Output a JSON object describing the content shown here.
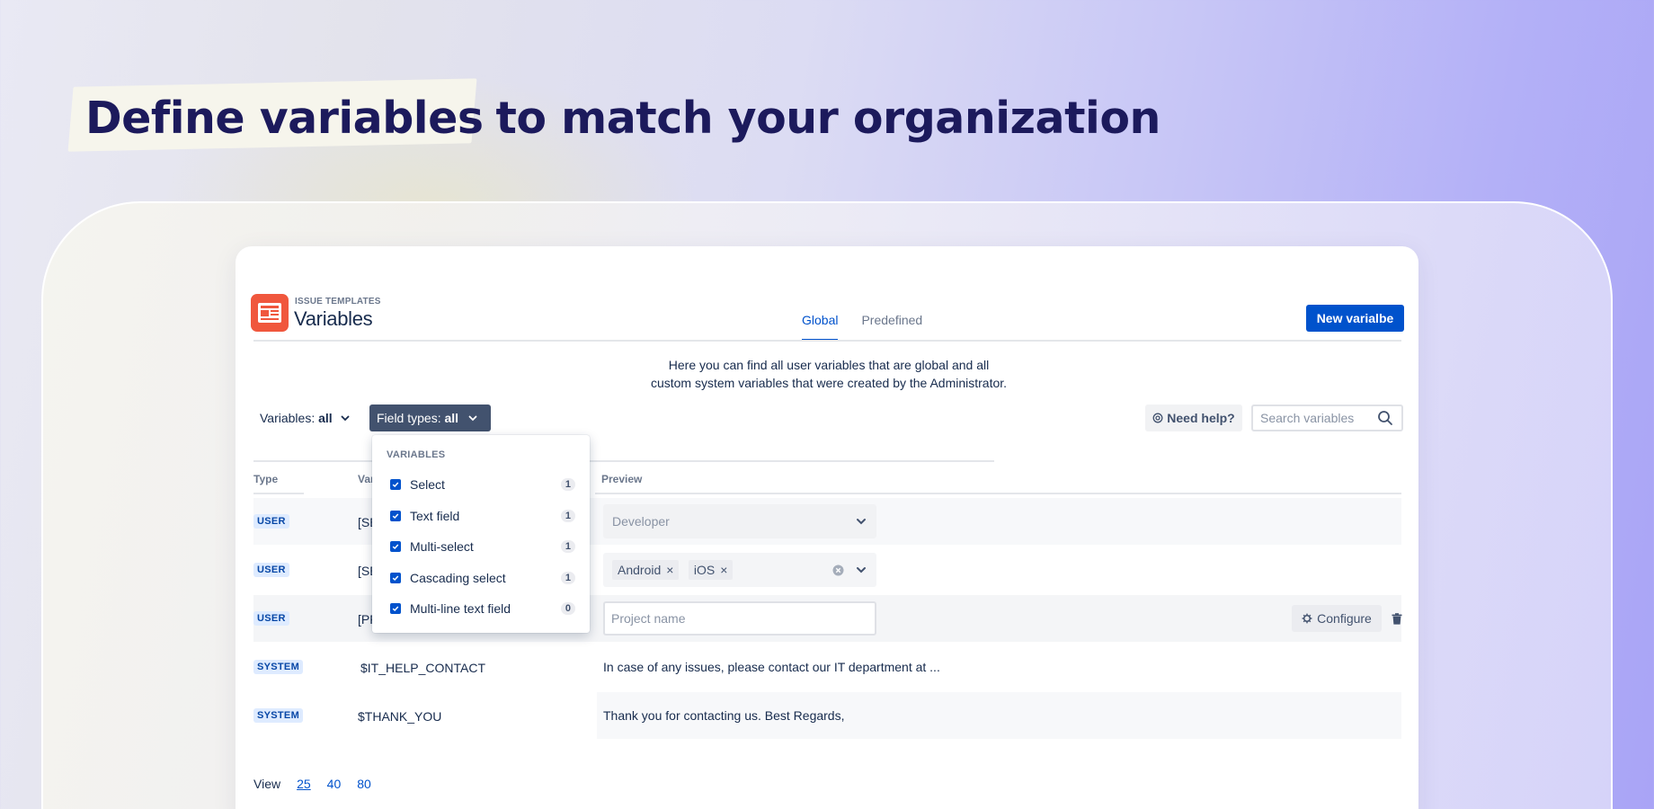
{
  "headline": {
    "highlight": "Define variables",
    "rest": "to match your organization"
  },
  "app": {
    "subtitle": "ISSUE TEMPLATES",
    "title": "Variables",
    "new_button": "New varialbe"
  },
  "tabs": [
    {
      "label": "Global",
      "active": true
    },
    {
      "label": "Predefined",
      "active": false
    }
  ],
  "description": {
    "line1": "Here you can find all user variables that are global and all",
    "line2": "custom system variables that were created by the Administrator."
  },
  "filters": {
    "variables_label": "Variables:",
    "variables_value": "all",
    "field_types_label": "Field types:",
    "field_types_value": "all",
    "help_label": "Need help?",
    "search_placeholder": "Search variables"
  },
  "dropdown": {
    "heading": "VARIABLES",
    "items": [
      {
        "label": "Select",
        "count": "1",
        "checked": true
      },
      {
        "label": "Text field",
        "count": "1",
        "checked": true
      },
      {
        "label": "Multi-select",
        "count": "1",
        "checked": true
      },
      {
        "label": "Cascading select",
        "count": "1",
        "checked": true
      },
      {
        "label": "Multi-line text field",
        "count": "0",
        "checked": true
      }
    ]
  },
  "table": {
    "headers": {
      "type": "Type",
      "variable": "Var",
      "preview": "Preview"
    },
    "rows": [
      {
        "type": "USER",
        "name": "[SE",
        "preview_placeholder": "Developer"
      },
      {
        "type": "USER",
        "name": "[SE",
        "chips": [
          "Android",
          "iOS"
        ]
      },
      {
        "type": "USER",
        "name": "[PF",
        "preview_placeholder": "Project name",
        "configure_label": "Configure"
      },
      {
        "type": "SYSTEM",
        "name": "$IT_HELP_CONTACT",
        "preview_text": "In case of any issues, please contact our IT department at ..."
      },
      {
        "type": "SYSTEM",
        "name": "$THANK_YOU",
        "preview_text": "Thank you for contacting us. Best Regards,"
      }
    ]
  },
  "pager": {
    "label": "View",
    "options": [
      "25",
      "40",
      "80"
    ],
    "current": "25"
  },
  "colors": {
    "primary": "#0052cc",
    "headline": "#1c1a5c",
    "logo": "#f0573d",
    "dropdown_trigger": "#42526e"
  }
}
